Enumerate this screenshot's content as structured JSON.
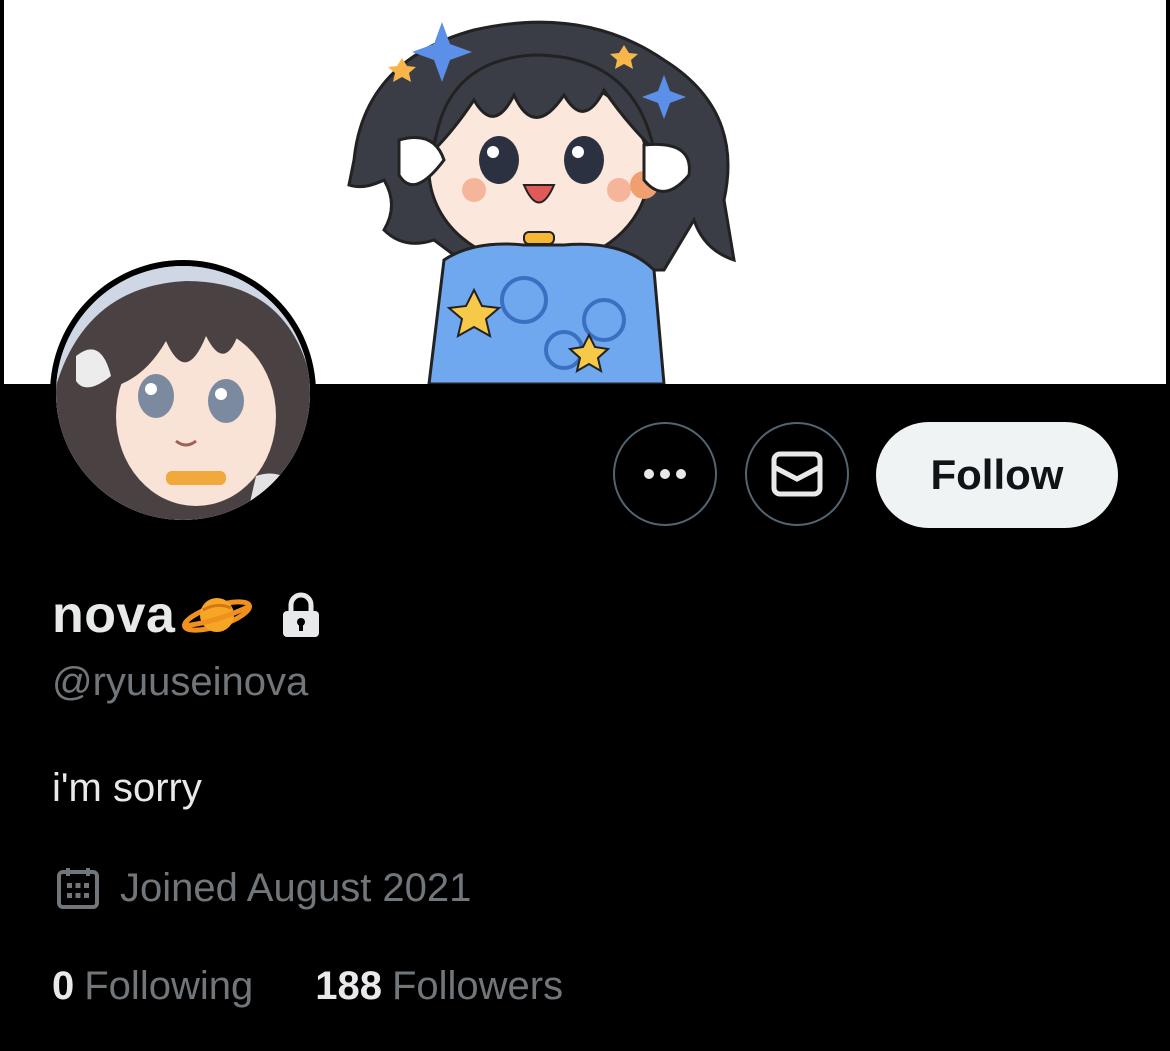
{
  "profile": {
    "display_name": "nova",
    "name_emoji": "ringed-planet-icon",
    "protected_icon": "lock-icon",
    "handle": "@ryuuseinova",
    "bio": "i'm sorry",
    "joined": "Joined August 2021",
    "following_count": "0",
    "following_label": "Following",
    "followers_count": "188",
    "followers_label": "Followers"
  },
  "actions": {
    "more_icon": "more-icon",
    "message_icon": "mail-icon",
    "follow_label": "Follow"
  },
  "colors": {
    "background": "#000000",
    "primary_text": "#e7e9ea",
    "secondary_text": "#71767b",
    "follow_button_bg": "#eff3f4",
    "follow_button_text": "#0f1419",
    "icon_button_border": "#536471"
  }
}
